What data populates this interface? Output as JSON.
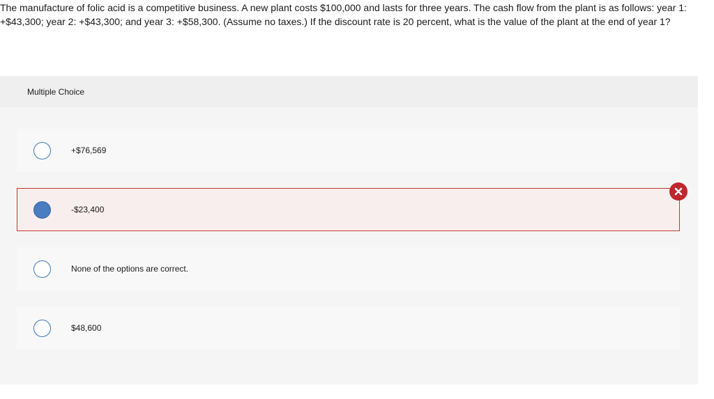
{
  "question": {
    "text": "The manufacture of folic acid is a competitive business. A new plant costs $100,000 and lasts for three years. The cash flow from the plant is as follows: year 1: +$43,300; year 2: +$43,300; and year 3: +$58,300. (Assume no taxes.) If the discount rate is 20 percent, what is the value of the plant at the end of year 1?"
  },
  "multiple_choice": {
    "label": "Multiple Choice",
    "options": [
      {
        "text": "+$76,569",
        "selected": false
      },
      {
        "text": "-$23,400",
        "selected": true,
        "status": "incorrect"
      },
      {
        "text": "None of the options are correct.",
        "selected": false
      },
      {
        "text": "$48,600",
        "selected": false
      }
    ]
  },
  "icons": {
    "incorrect": "close-icon"
  },
  "colors": {
    "radio_border": "#3d78b8",
    "radio_selected": "#4a7cc0",
    "incorrect_border": "#c0392b",
    "incorrect_badge": "#c0272d",
    "selected_background": "#f9eeee"
  }
}
